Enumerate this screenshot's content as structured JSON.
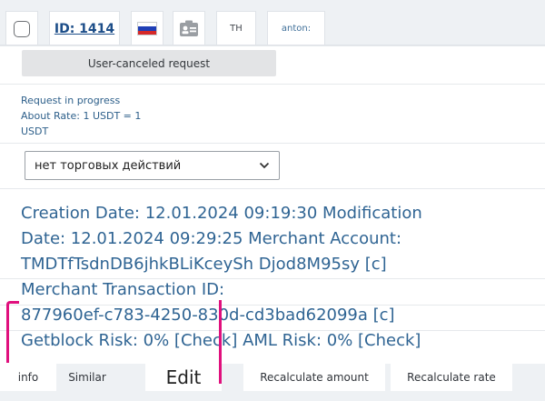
{
  "header": {
    "id_label": "ID: 1414",
    "flag_colors": [
      "#ffffff",
      "#1f3fb6",
      "#d62828"
    ],
    "lang_code": "TH",
    "user_label": "anton:"
  },
  "actions": {
    "cancel_label": "User-canceled request"
  },
  "status": {
    "line1": "Request in progress",
    "line2": "About Rate: 1 USDT = 1",
    "line3": "USDT"
  },
  "trade_select": {
    "selected": "нет торговых действий"
  },
  "details": {
    "line1": "Creation Date: 12.01.2024 09:19:30 Modification",
    "line2": "Date: 12.01.2024 09:29:25 Merchant Account:",
    "line3": "TMDTfTsdnDB6jhkBLiKceySh Djod8M95sy [c]",
    "line4": "Merchant Transaction ID:",
    "line5": "877960ef-c783-4250-830d-cd3bad62099a [c]",
    "line6": "Getblock Risk: 0% [Check] AML Risk: 0% [Check]"
  },
  "footer": {
    "tab_info": "info",
    "tab_similar": "Similar",
    "tab_edit": "Edit",
    "tab_recalc_amount": "Recalculate amount",
    "tab_recalc_rate": "Recalculate rate"
  },
  "colors": {
    "accent_text": "#2f6493",
    "highlight": "#e0107d"
  }
}
